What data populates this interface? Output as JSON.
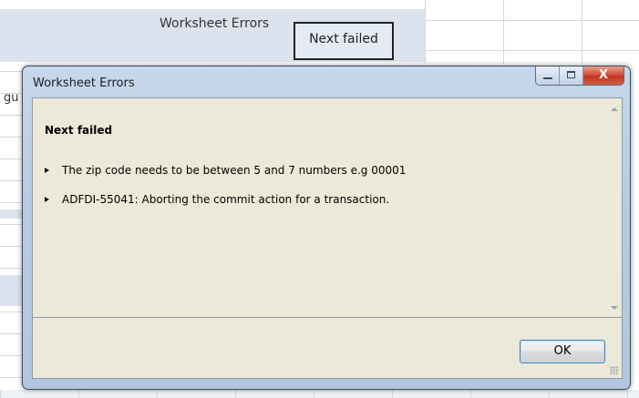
{
  "background": {
    "worksheet_label": "Worksheet Errors",
    "button_label": "Next failed",
    "cut_off_text": "gu"
  },
  "dialog": {
    "title": "Worksheet Errors",
    "window_controls": {
      "minimize_icon": "minimize-icon",
      "maximize_icon": "maximize-icon",
      "close_label": "X"
    },
    "heading": "Next failed",
    "messages": [
      "The zip code needs to be between 5 and 7 numbers e.g 00001",
      "ADFDI-55041: Aborting the commit action for a transaction."
    ],
    "ok_label": "OK"
  },
  "colors": {
    "dialog_body": "#ece9d8",
    "frame": "#b9cbe2",
    "close_button": "#c1341c",
    "worksheet_band": "#dde3ee"
  }
}
